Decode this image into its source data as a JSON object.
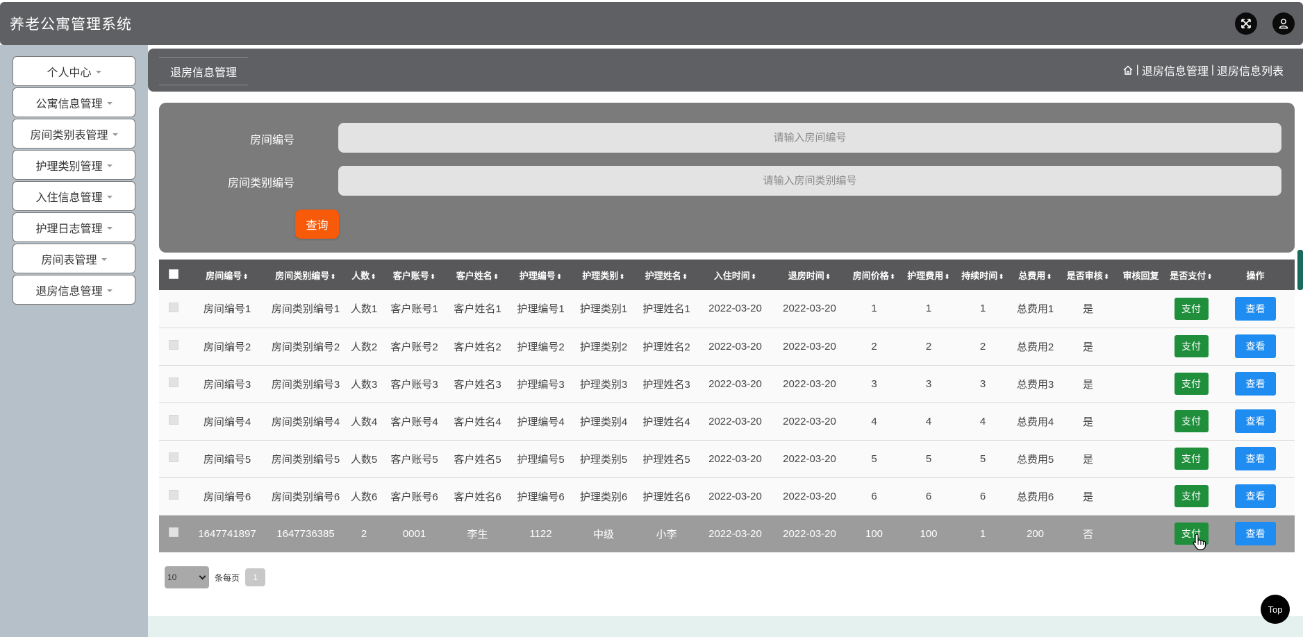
{
  "app": {
    "title": "养老公寓管理系统"
  },
  "header": {
    "fullscreen_icon": "fullscreen-icon",
    "user_icon": "user-icon"
  },
  "sidebar": {
    "items": [
      {
        "label": "个人中心"
      },
      {
        "label": "公寓信息管理"
      },
      {
        "label": "房间类别表管理"
      },
      {
        "label": "护理类别管理"
      },
      {
        "label": "入住信息管理"
      },
      {
        "label": "护理日志管理"
      },
      {
        "label": "房间表管理"
      },
      {
        "label": "退房信息管理"
      }
    ]
  },
  "breadcrumb": {
    "tab": "退房信息管理",
    "sep": "|",
    "level1": "退房信息管理",
    "level2": "退房信息列表"
  },
  "search": {
    "room_no_label": "房间编号",
    "room_no_placeholder": "请输入房间编号",
    "room_type_label": "房间类别编号",
    "room_type_placeholder": "请输入房间类别编号",
    "query_label": "查询"
  },
  "table": {
    "columns": [
      {
        "label": "房间编号",
        "sortable": true
      },
      {
        "label": "房间类别编号",
        "sortable": true
      },
      {
        "label": "人数",
        "sortable": true
      },
      {
        "label": "客户账号",
        "sortable": true
      },
      {
        "label": "客户姓名",
        "sortable": true
      },
      {
        "label": "护理编号",
        "sortable": true
      },
      {
        "label": "护理类别",
        "sortable": true
      },
      {
        "label": "护理姓名",
        "sortable": true
      },
      {
        "label": "入住时间",
        "sortable": true
      },
      {
        "label": "退房时间",
        "sortable": true
      },
      {
        "label": "房间价格",
        "sortable": true
      },
      {
        "label": "护理费用",
        "sortable": true
      },
      {
        "label": "持续时间",
        "sortable": true
      },
      {
        "label": "总费用",
        "sortable": true
      },
      {
        "label": "是否审核",
        "sortable": true
      },
      {
        "label": "审核回复",
        "sortable": false
      },
      {
        "label": "是否支付",
        "sortable": true
      },
      {
        "label": "操作",
        "sortable": false
      }
    ],
    "sort_glyph": "⬍",
    "pay_label": "支付",
    "view_label": "查看",
    "rows": [
      [
        "房间编号1",
        "房间类别编号1",
        "人数1",
        "客户账号1",
        "客户姓名1",
        "护理编号1",
        "护理类别1",
        "护理姓名1",
        "2022-03-20",
        "2022-03-20",
        "1",
        "1",
        "1",
        "总费用1",
        "是",
        ""
      ],
      [
        "房间编号2",
        "房间类别编号2",
        "人数2",
        "客户账号2",
        "客户姓名2",
        "护理编号2",
        "护理类别2",
        "护理姓名2",
        "2022-03-20",
        "2022-03-20",
        "2",
        "2",
        "2",
        "总费用2",
        "是",
        ""
      ],
      [
        "房间编号3",
        "房间类别编号3",
        "人数3",
        "客户账号3",
        "客户姓名3",
        "护理编号3",
        "护理类别3",
        "护理姓名3",
        "2022-03-20",
        "2022-03-20",
        "3",
        "3",
        "3",
        "总费用3",
        "是",
        ""
      ],
      [
        "房间编号4",
        "房间类别编号4",
        "人数4",
        "客户账号4",
        "客户姓名4",
        "护理编号4",
        "护理类别4",
        "护理姓名4",
        "2022-03-20",
        "2022-03-20",
        "4",
        "4",
        "4",
        "总费用4",
        "是",
        ""
      ],
      [
        "房间编号5",
        "房间类别编号5",
        "人数5",
        "客户账号5",
        "客户姓名5",
        "护理编号5",
        "护理类别5",
        "护理姓名5",
        "2022-03-20",
        "2022-03-20",
        "5",
        "5",
        "5",
        "总费用5",
        "是",
        ""
      ],
      [
        "房间编号6",
        "房间类别编号6",
        "人数6",
        "客户账号6",
        "客户姓名6",
        "护理编号6",
        "护理类别6",
        "护理姓名6",
        "2022-03-20",
        "2022-03-20",
        "6",
        "6",
        "6",
        "总费用6",
        "是",
        ""
      ],
      [
        "1647741897",
        "1647736385",
        "2",
        "0001",
        "李生",
        "1122",
        "中级",
        "小李",
        "2022-03-20",
        "2022-03-20",
        "100",
        "100",
        "1",
        "200",
        "否",
        ""
      ]
    ]
  },
  "pagination": {
    "page_size": "10",
    "per_page_label": "条每页",
    "current_page": "1"
  },
  "back_to_top": {
    "label": "Top"
  },
  "colors": {
    "query_button": "#f75a08",
    "pay_button": "#1f8f3c",
    "view_button": "#1e8cf0",
    "header": "#5f6063"
  }
}
